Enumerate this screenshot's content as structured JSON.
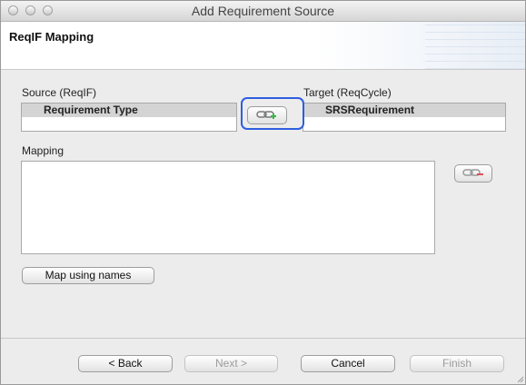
{
  "window": {
    "title": "Add Requirement Source"
  },
  "header": {
    "title": "ReqIF Mapping"
  },
  "source": {
    "label": "Source (ReqIF)",
    "items": [
      "Requirement Type"
    ]
  },
  "target": {
    "label": "Target (ReqCycle)",
    "items": [
      "SRSRequirement"
    ]
  },
  "mapping": {
    "label": "Mapping",
    "items": []
  },
  "buttons": {
    "add_mapping_icon": "link-add-icon",
    "remove_mapping_icon": "link-remove-icon",
    "map_names": "Map using names",
    "back": "< Back",
    "next": "Next >",
    "cancel": "Cancel",
    "finish": "Finish"
  },
  "colors": {
    "focus": "#2f5ee0",
    "add_badge": "#3bb54a",
    "remove_badge": "#e05050"
  }
}
